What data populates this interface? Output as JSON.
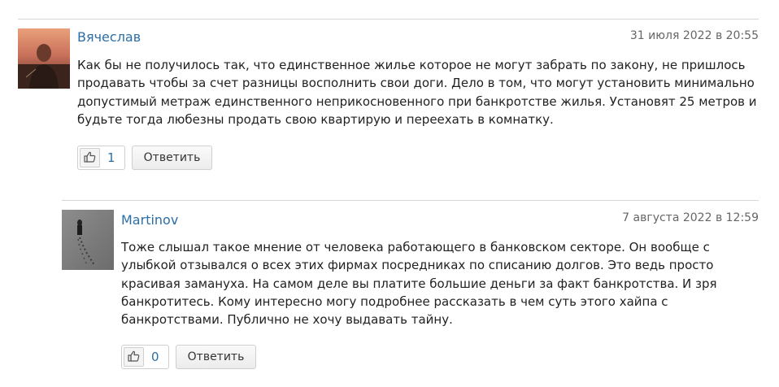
{
  "comments": [
    {
      "author": "Вячеслав",
      "date": "31 июля 2022 в 20:55",
      "text": "Как бы не получилось так, что единственное жилье которое не могут забрать по закону, не пришлось продавать чтобы за счет разницы восполнить свои доги. Дело в том, что могут установить минимально допустимый метраж единственного неприкосновенного при банкротстве жилья. Установят 25 метров и будьте тогда любезны продать свою квартирую и переехать в комнатку.",
      "likes": "1",
      "reply_label": "Ответить",
      "like_icon": "thumbs-up-icon"
    },
    {
      "author": "Martinov",
      "date": "7 августа 2022 в 12:59",
      "text": "Тоже слышал такое мнение от человека работающего в банковском секторе. Он вообще с улыбкой отзывался о всех этих фирмах посредниках по списанию долгов. Это ведь просто красивая замануха. На самом деле вы платите большие деньги за факт банкротства. И зря банкротитесь. Кому интересно могу подробнее рассказать в чем суть этого хайпа с банкротствами. Публично не хочу выдавать тайну.",
      "likes": "0",
      "reply_label": "Ответить",
      "like_icon": "thumbs-up-icon"
    }
  ],
  "colors": {
    "author_link": "#2c6ea5",
    "like_count": "#2c6ea5",
    "date_text": "#666666",
    "body_text": "#222222",
    "divider": "#d6d6d6"
  }
}
